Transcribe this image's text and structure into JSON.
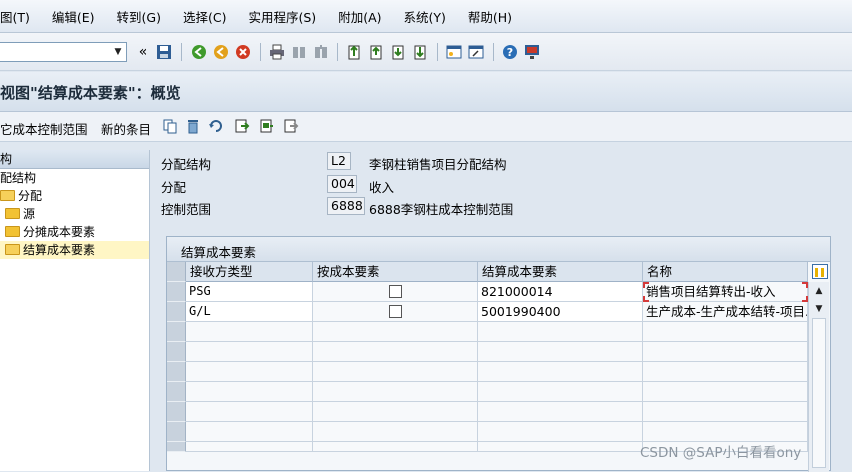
{
  "menu": [
    "图(T)",
    "编辑(E)",
    "转到(G)",
    "选择(C)",
    "实用程序(S)",
    "附加(A)",
    "系统(Y)",
    "帮助(H)"
  ],
  "toolbar": {
    "command_field_value": "",
    "icons": [
      "collapse-arrows-icon",
      "save-icon",
      "back-icon",
      "exit-icon",
      "cancel-icon",
      "print-icon",
      "find-icon",
      "find-next-icon",
      "first-page-icon",
      "previous-page-icon",
      "next-page-icon",
      "last-page-icon",
      "new-session-icon",
      "shortcut-icon",
      "help-icon",
      "customize-layout-icon"
    ]
  },
  "title": "视图\"结算成本要素\"：概览",
  "app_toolbar": {
    "other_area_label": "它成本控制范围",
    "new_entries_label": "新的条目",
    "icons": [
      "copy-icon",
      "delete-icon",
      "undo-icon",
      "select-all-icon",
      "select-block-icon",
      "deselect-all-icon"
    ]
  },
  "tree": {
    "header": "构",
    "nodes": [
      {
        "label": "配结构",
        "level": 0,
        "folder": false
      },
      {
        "label": "分配",
        "level": 1,
        "folder": true
      },
      {
        "label": "源",
        "level": 2,
        "folder": true
      },
      {
        "label": "分摊成本要素",
        "level": 2,
        "folder": true
      },
      {
        "label": "结算成本要素",
        "level": 2,
        "folder": true,
        "selected": true
      }
    ]
  },
  "header_fields": {
    "structure_label": "分配结构",
    "structure_value": "L2",
    "structure_text": "李钢柱销售项目分配结构",
    "assignment_label": "分配",
    "assignment_value": "004",
    "assignment_text": "收入",
    "area_label": "控制范围",
    "area_value": "6888",
    "area_text": "6888李钢柱成本控制范围"
  },
  "table": {
    "title": "结算成本要素",
    "columns": [
      "接收方类型",
      "按成本要素",
      "结算成本要素",
      "名称"
    ],
    "rows": [
      {
        "receiver_type": "PSG",
        "by_cost_element": false,
        "settlement_cost_element": "821000014",
        "name": "销售项目结算转出-收入"
      },
      {
        "receiver_type": "G/L",
        "by_cost_element": false,
        "settlement_cost_element": "5001990400",
        "name": "生产成本-生产成本结转-项目..."
      }
    ],
    "empty_rows": 8
  },
  "watermark": "CSDN @SAP小白看看ony",
  "colors": {
    "background": "#dfe7f0",
    "selected_tree_row": "#fff6c5",
    "focus_border": "#d43a3a"
  }
}
